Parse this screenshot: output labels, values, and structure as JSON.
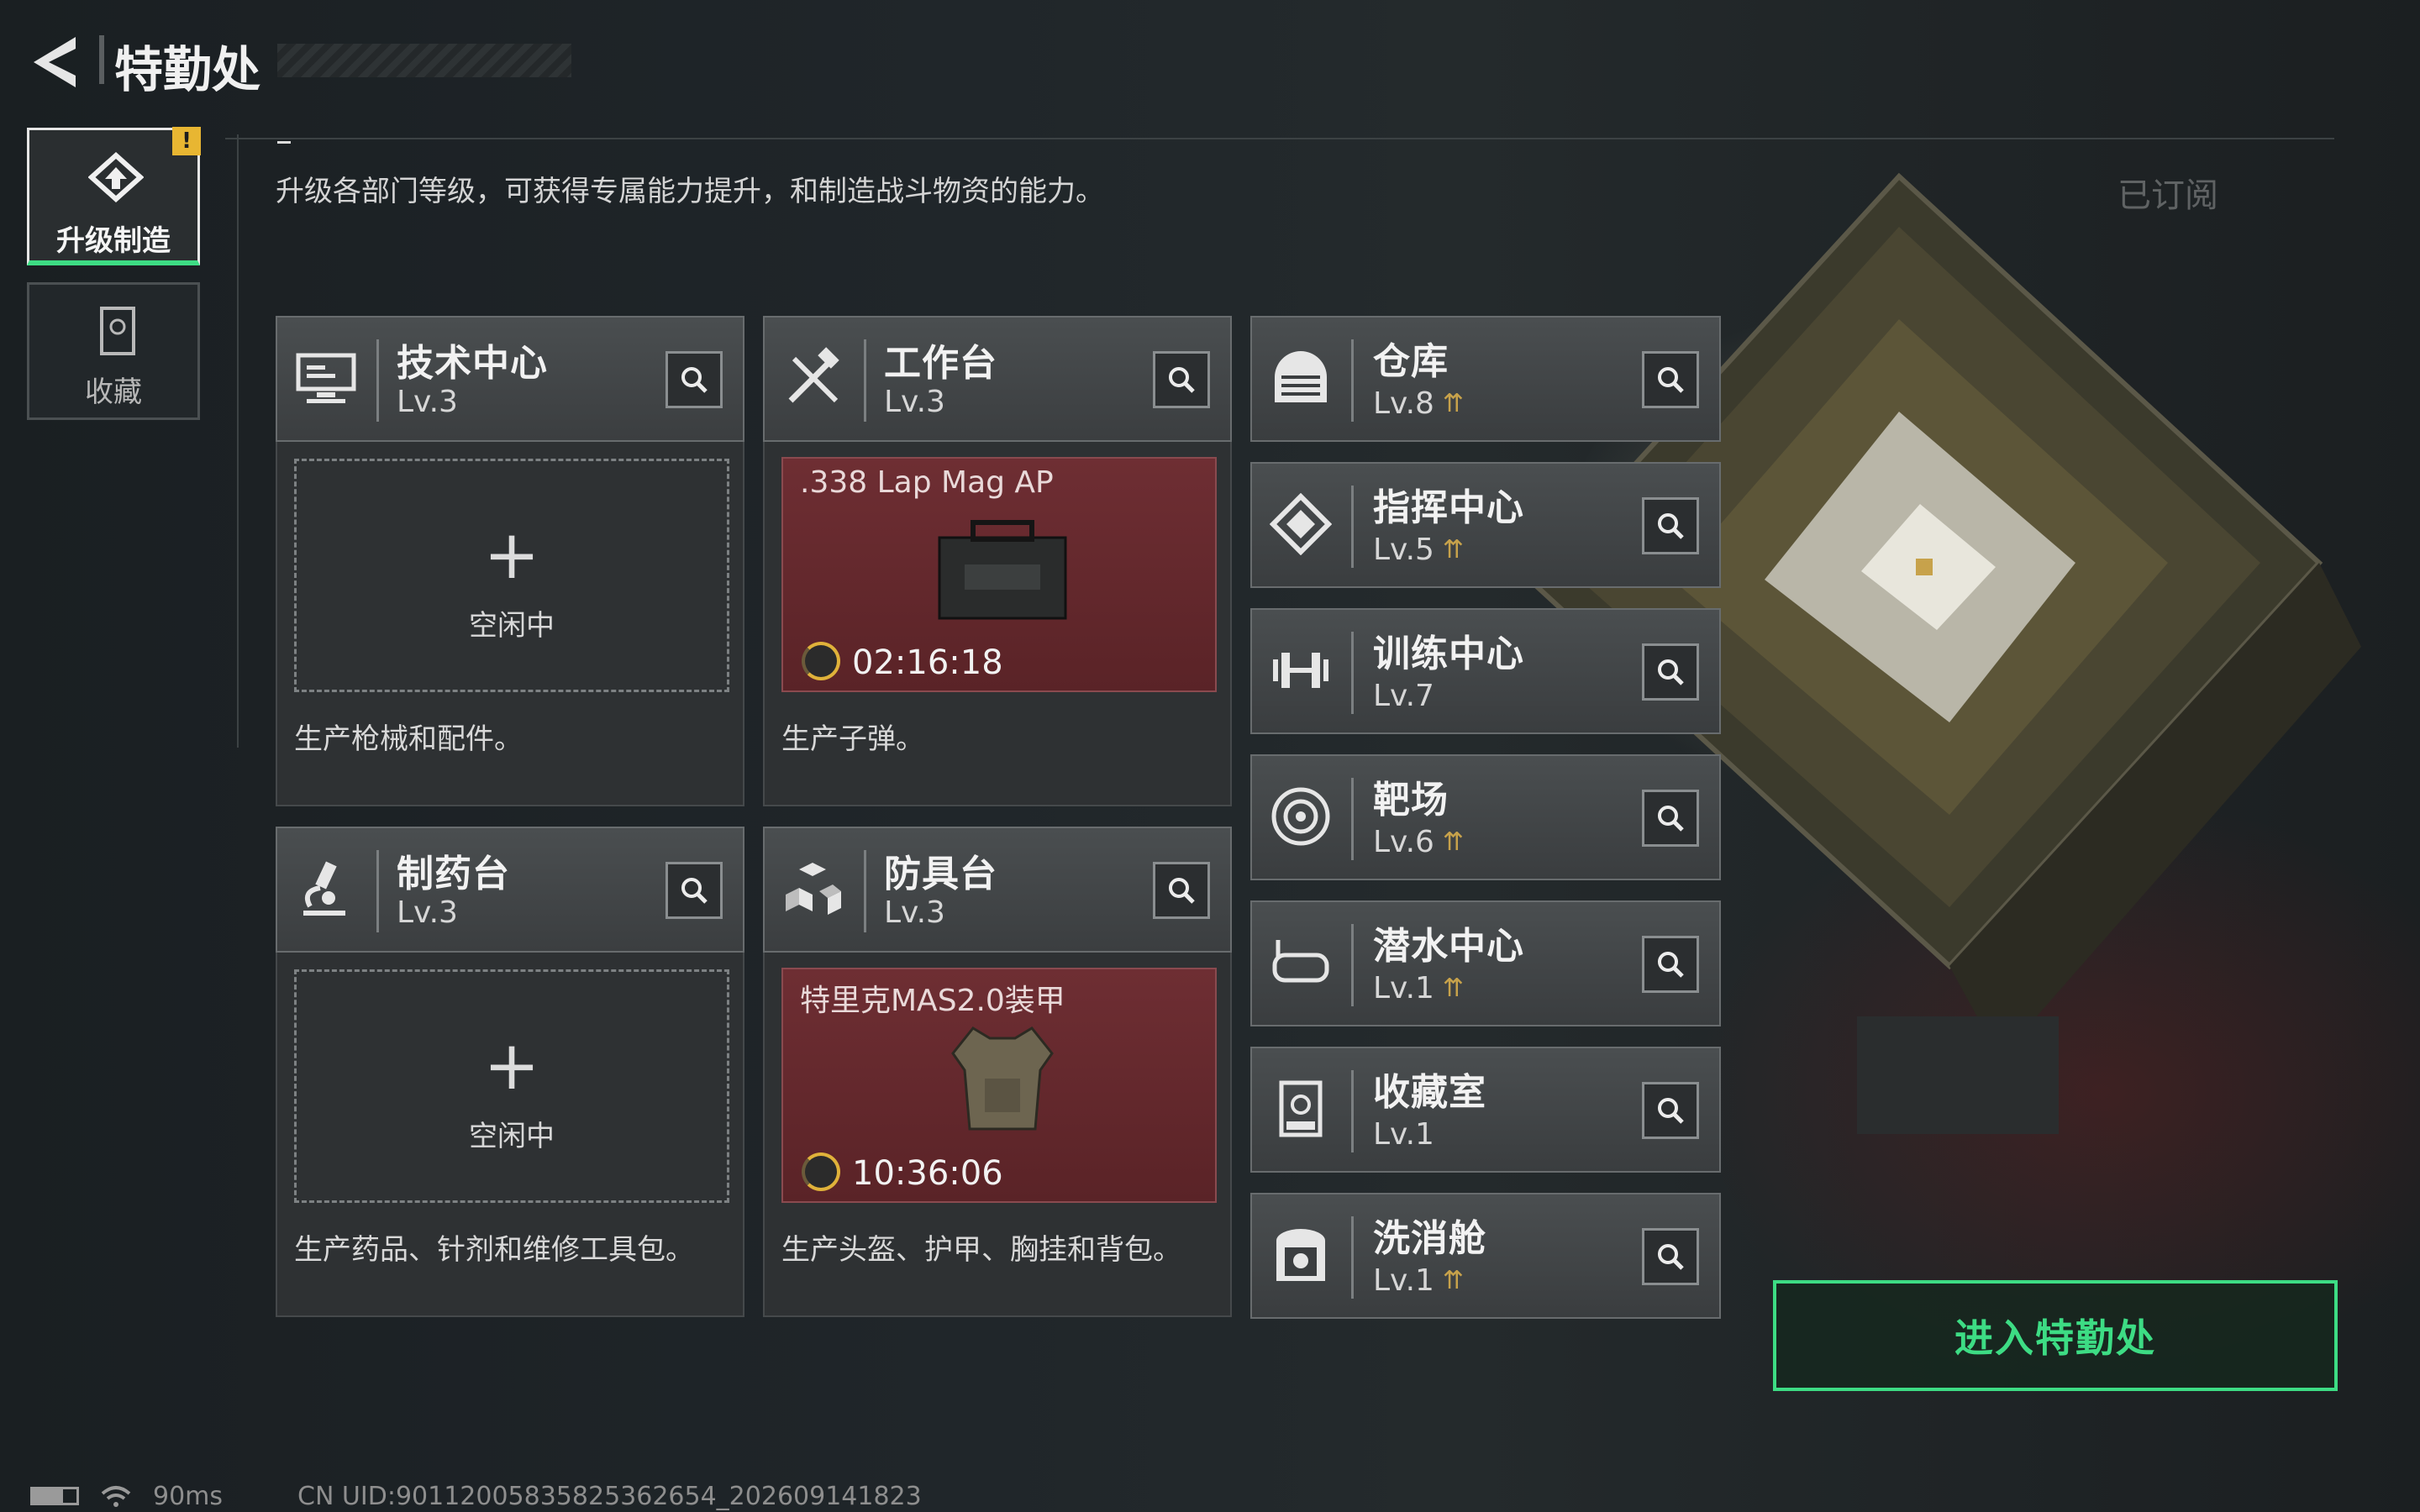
{
  "header": {
    "title": "特勤处"
  },
  "tabs": [
    {
      "label": "升级制造",
      "badge": "!"
    },
    {
      "label": "收藏"
    }
  ],
  "subtitle": "升级各部门等级，可获得专属能力提升，和制造战斗物资的能力。",
  "subscribed_label": "已订阅",
  "workbenches": [
    {
      "name": "技术中心",
      "level": "Lv.3",
      "status": "空闲中",
      "desc": "生产枪械和配件。"
    },
    {
      "name": "工作台",
      "level": "Lv.3",
      "item": ".338 Lap Mag AP",
      "timer": "02:16:18",
      "desc": "生产子弹。"
    },
    {
      "name": "制药台",
      "level": "Lv.3",
      "status": "空闲中",
      "desc": "生产药品、针剂和维修工具包。"
    },
    {
      "name": "防具台",
      "level": "Lv.3",
      "item": "特里克MAS2.0装甲",
      "timer": "10:36:06",
      "desc": "生产头盔、护甲、胸挂和背包。"
    }
  ],
  "facilities": [
    {
      "name": "仓库",
      "level": "Lv.8",
      "upgradable": true
    },
    {
      "name": "指挥中心",
      "level": "Lv.5",
      "upgradable": true
    },
    {
      "name": "训练中心",
      "level": "Lv.7",
      "upgradable": false
    },
    {
      "name": "靶场",
      "level": "Lv.6",
      "upgradable": true
    },
    {
      "name": "潜水中心",
      "level": "Lv.1",
      "upgradable": true
    },
    {
      "name": "收藏室",
      "level": "Lv.1",
      "upgradable": false
    },
    {
      "name": "洗消舱",
      "level": "Lv.1",
      "upgradable": true
    }
  ],
  "enter_button": "进入特勤处",
  "status_bar": {
    "ping": "90ms",
    "uid": "CN UID:901120058358253626​54_202609141823"
  },
  "colors": {
    "accent": "#3ddc84",
    "upgrade_arrow": "#c7a24b",
    "badge": "#e8b632",
    "production_bg": "#6e2e33"
  }
}
